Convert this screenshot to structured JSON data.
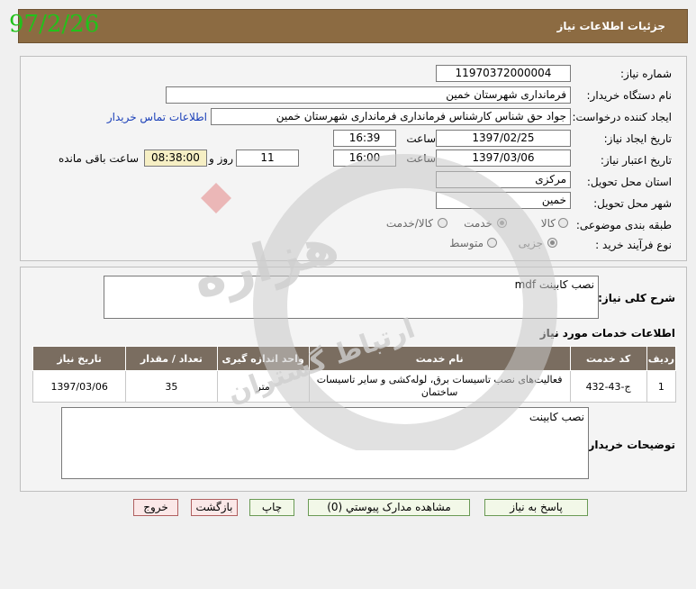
{
  "stamp_date": "97/2/26",
  "title": "جزئیات اطلاعات نیاز",
  "fields": {
    "need_number_label": "شماره نیاز:",
    "need_number": "11970372000004",
    "buyer_label": "نام دستگاه خریدار:",
    "buyer": "فرمانداری شهرستان خمین",
    "creator_label": "ایجاد کننده درخواست:",
    "creator": "جواد حق شناس کارشناس فرمانداری فرمانداری شهرستان خمین",
    "contact_link": "اطلاعات تماس خریدار",
    "created_label": "تاریخ ایجاد نیاز:",
    "created_date": "1397/02/25",
    "time_label": "ساعت",
    "created_time": "16:39",
    "valid_label": "تاریخ اعتبار نیاز:",
    "valid_date": "1397/03/06",
    "valid_time": "16:00",
    "days": "11",
    "days_label": "روز و",
    "remaining_time": "08:38:00",
    "remaining_label": "ساعت باقی مانده",
    "province_label": "استان محل تحویل:",
    "province": "مرکزی",
    "city_label": "شهر محل تحویل:",
    "city": "خمین",
    "category_label": "طبقه بندی موضوعی:",
    "category_options": [
      "کالا",
      "خدمت",
      "کالا/خدمت"
    ],
    "process_label": "نوع فرآیند خرید :",
    "process_options": [
      "جزیی",
      "متوسط"
    ]
  },
  "description": {
    "label": "شرح کلی نیاز:",
    "text": "نصب کابینت mdf"
  },
  "services": {
    "title": "اطلاعات خدمات مورد نیاز",
    "headers": [
      "ردیف",
      "کد خدمت",
      "نام خدمت",
      "واحد اندازه گیری",
      "تعداد / مقدار",
      "تاریخ نیاز"
    ],
    "rows": [
      {
        "row": "1",
        "code": "ج-43-432",
        "name": "فعالیت‌های نصب تاسیسات برق، لوله‌کشی و سایر تاسیسات ساختمان",
        "unit": "متر",
        "qty": "35",
        "date": "1397/03/06"
      }
    ]
  },
  "buyer_notes": {
    "label": "توضیحات خریدار:",
    "text": "نصب کابینت"
  },
  "buttons": {
    "reply": "پاسخ به نیاز",
    "attachments": "مشاهده مدارک پیوستي (0)",
    "print": "چاپ",
    "back": "بازگشت",
    "exit": "خروج"
  },
  "watermark": {
    "main": "هزاره",
    "sub": "ارتباط گستران"
  }
}
